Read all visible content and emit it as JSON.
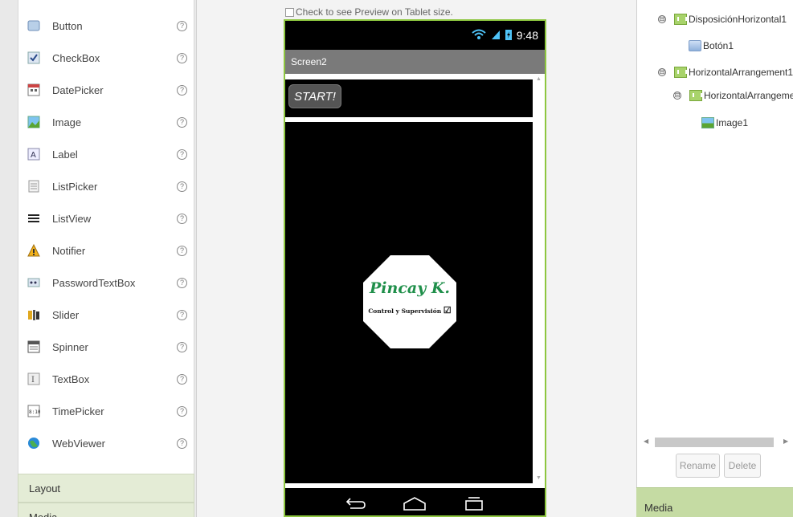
{
  "palette": {
    "items": [
      {
        "label": "Button",
        "icon": "button-icon",
        "help": "?"
      },
      {
        "label": "CheckBox",
        "icon": "checkbox-icon",
        "help": "?"
      },
      {
        "label": "DatePicker",
        "icon": "datepicker-icon",
        "help": "?"
      },
      {
        "label": "Image",
        "icon": "image-icon",
        "help": "?"
      },
      {
        "label": "Label",
        "icon": "label-icon",
        "help": "?"
      },
      {
        "label": "ListPicker",
        "icon": "listpicker-icon",
        "help": "?"
      },
      {
        "label": "ListView",
        "icon": "listview-icon",
        "help": "?"
      },
      {
        "label": "Notifier",
        "icon": "notifier-icon",
        "help": "?"
      },
      {
        "label": "PasswordTextBox",
        "icon": "passwordtextbox-icon",
        "help": "?"
      },
      {
        "label": "Slider",
        "icon": "slider-icon",
        "help": "?"
      },
      {
        "label": "Spinner",
        "icon": "spinner-icon",
        "help": "?"
      },
      {
        "label": "TextBox",
        "icon": "textbox-icon",
        "help": "?"
      },
      {
        "label": "TimePicker",
        "icon": "timepicker-icon",
        "help": "?"
      },
      {
        "label": "WebViewer",
        "icon": "webviewer-icon",
        "help": "?"
      }
    ],
    "categories": {
      "layout": "Layout",
      "media": "Media"
    }
  },
  "viewer": {
    "tablet_preview_label": "Check to see Preview on Tablet size.",
    "status_time": "9:48",
    "screen_title": "Screen2",
    "start_button": "START!",
    "logo_name": "Pincay K.",
    "logo_subtitle": "Control y Supervisión",
    "border_color": "#8dc63f"
  },
  "components": {
    "tree": [
      {
        "label": "DisposiciónHorizontal1",
        "type": "arrangement",
        "toggle": "⊟"
      },
      {
        "label": "Botón1",
        "type": "button"
      },
      {
        "label": "HorizontalArrangement1",
        "type": "arrangement",
        "toggle": "⊟"
      },
      {
        "label": "HorizontalArrangement",
        "type": "arrangement",
        "toggle": "⊟"
      },
      {
        "label": "Image1",
        "type": "image"
      }
    ],
    "rename_label": "Rename",
    "delete_label": "Delete"
  },
  "media": {
    "header": "Media"
  }
}
